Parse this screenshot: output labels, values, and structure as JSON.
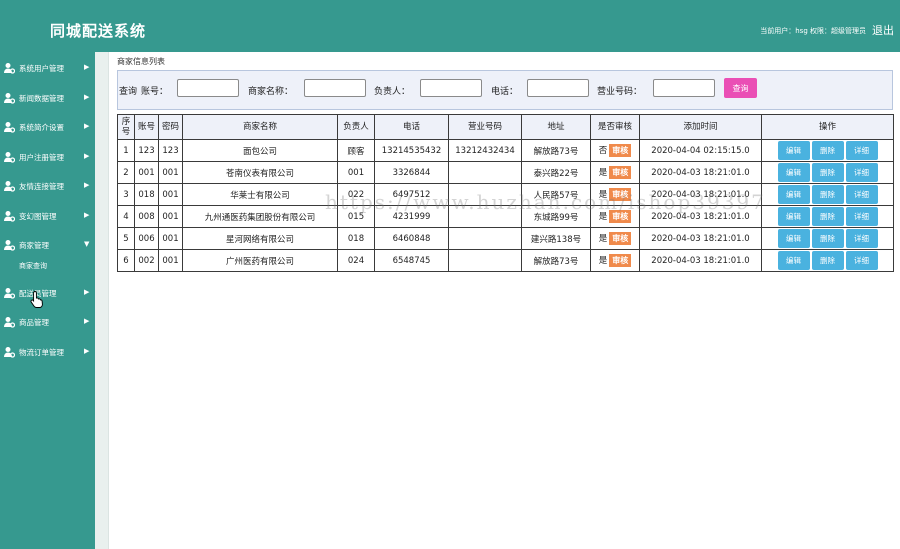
{
  "header": {
    "title": "同城配送系统",
    "user_info": "当前用户：hsg  权限：超级管理员",
    "logout": "退出"
  },
  "sidebar": {
    "items": [
      {
        "label": "系统用户管理"
      },
      {
        "label": "新闻数据管理"
      },
      {
        "label": "系统简介设置"
      },
      {
        "label": "用户注册管理"
      },
      {
        "label": "友情连接管理"
      },
      {
        "label": "变幻图管理"
      },
      {
        "label": "商家管理",
        "expanded": true,
        "sub": [
          {
            "label": "商家查询"
          }
        ]
      },
      {
        "label": "配送员管理"
      },
      {
        "label": "商品管理"
      },
      {
        "label": "物流订单管理"
      }
    ]
  },
  "main": {
    "breadcrumb": "商家信息列表",
    "search": {
      "prefix": "查询",
      "account_label": "账号：",
      "name_label": "商家名称：",
      "owner_label": "负责人：",
      "phone_label": "电话：",
      "license_label": "营业号码：",
      "button": "查询"
    },
    "table": {
      "headers": [
        "序号",
        "账号",
        "密码",
        "商家名称",
        "负责人",
        "电话",
        "营业号码",
        "地址",
        "是否审核",
        "添加时间",
        "操作"
      ],
      "rows": [
        {
          "no": "1",
          "account": "123",
          "password": "123",
          "name": "面包公司",
          "owner": "顾客",
          "phone": "13214535432",
          "license": "13212432434",
          "address": "解放路73号",
          "approved": "否",
          "time": "2020-04-04 02:15:15.0"
        },
        {
          "no": "2",
          "account": "001",
          "password": "001",
          "name": "苍南仪表有限公司",
          "owner": "001",
          "phone": "3326844",
          "license": "",
          "address": "泰兴路22号",
          "approved": "是",
          "time": "2020-04-03 18:21:01.0"
        },
        {
          "no": "3",
          "account": "018",
          "password": "001",
          "name": "华莱士有限公司",
          "owner": "022",
          "phone": "6497512",
          "license": "",
          "address": "人民路57号",
          "approved": "是",
          "time": "2020-04-03 18:21:01.0"
        },
        {
          "no": "4",
          "account": "008",
          "password": "001",
          "name": "九州通医药集团股份有限公司",
          "owner": "015",
          "phone": "4231999",
          "license": "",
          "address": "东城路99号",
          "approved": "是",
          "time": "2020-04-03 18:21:01.0"
        },
        {
          "no": "5",
          "account": "006",
          "password": "001",
          "name": "星河网络有限公司",
          "owner": "018",
          "phone": "6460848",
          "license": "",
          "address": "建兴路138号",
          "approved": "是",
          "time": "2020-04-03 18:21:01.0"
        },
        {
          "no": "6",
          "account": "002",
          "password": "001",
          "name": "广州医药有限公司",
          "owner": "024",
          "phone": "6548745",
          "license": "",
          "address": "解放路73号",
          "approved": "是",
          "time": "2020-04-03 18:21:01.0"
        }
      ],
      "audit_label": "审核",
      "ops": {
        "edit": "编辑",
        "delete": "删除",
        "detail": "详细"
      }
    }
  },
  "watermark": "https://www.huzhan.com/ishop39397",
  "colors": {
    "teal": "#36998f",
    "query_button": "#ea4fb5",
    "audit_badge": "#f08a4b",
    "op_button": "#4ab2df",
    "search_bg": "#eef1f9"
  },
  "icons": {
    "nav": "user-gear-icon",
    "arrow": "triangle-right-icon",
    "expanded": "triangle-down-icon",
    "cursor": "hand-cursor-icon"
  }
}
